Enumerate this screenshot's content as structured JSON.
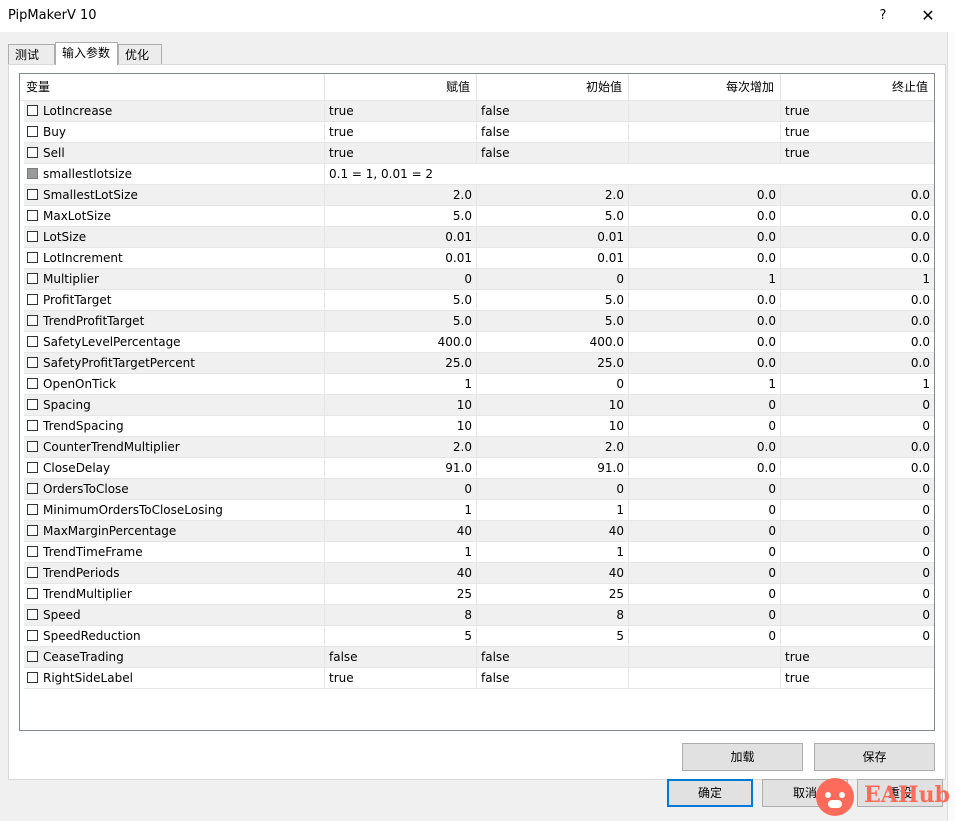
{
  "window": {
    "title": "PipMakerV 10",
    "help_label": "?",
    "close_label": "✕"
  },
  "tabs": [
    {
      "label": "测试",
      "active": false
    },
    {
      "label": "输入参数",
      "active": true
    },
    {
      "label": "优化",
      "active": false
    }
  ],
  "columns": [
    "变量",
    "赋值",
    "初始值",
    "每次增加",
    "终止值"
  ],
  "rows": [
    {
      "name": "LotIncrease",
      "value": "true",
      "start": "false",
      "step": "",
      "stop": "true",
      "type": "text"
    },
    {
      "name": "Buy",
      "value": "true",
      "start": "false",
      "step": "",
      "stop": "true",
      "type": "text"
    },
    {
      "name": "Sell",
      "value": "true",
      "start": "false",
      "step": "",
      "stop": "true",
      "type": "text"
    },
    {
      "name": "smallestlotsize",
      "value": "0.1 = 1, 0.01 = 2",
      "start": "",
      "step": "",
      "stop": "",
      "type": "comment"
    },
    {
      "name": "SmallestLotSize",
      "value": "2.0",
      "start": "2.0",
      "step": "0.0",
      "stop": "0.0",
      "type": "num"
    },
    {
      "name": "MaxLotSize",
      "value": "5.0",
      "start": "5.0",
      "step": "0.0",
      "stop": "0.0",
      "type": "num"
    },
    {
      "name": "LotSize",
      "value": "0.01",
      "start": "0.01",
      "step": "0.0",
      "stop": "0.0",
      "type": "num"
    },
    {
      "name": "LotIncrement",
      "value": "0.01",
      "start": "0.01",
      "step": "0.0",
      "stop": "0.0",
      "type": "num"
    },
    {
      "name": "Multiplier",
      "value": "0",
      "start": "0",
      "step": "1",
      "stop": "1",
      "type": "num"
    },
    {
      "name": "ProfitTarget",
      "value": "5.0",
      "start": "5.0",
      "step": "0.0",
      "stop": "0.0",
      "type": "num"
    },
    {
      "name": "TrendProfitTarget",
      "value": "5.0",
      "start": "5.0",
      "step": "0.0",
      "stop": "0.0",
      "type": "num"
    },
    {
      "name": "SafetyLevelPercentage",
      "value": "400.0",
      "start": "400.0",
      "step": "0.0",
      "stop": "0.0",
      "type": "num"
    },
    {
      "name": "SafetyProfitTargetPercent",
      "value": "25.0",
      "start": "25.0",
      "step": "0.0",
      "stop": "0.0",
      "type": "num"
    },
    {
      "name": "OpenOnTick",
      "value": "1",
      "start": "0",
      "step": "1",
      "stop": "1",
      "type": "num"
    },
    {
      "name": "Spacing",
      "value": "10",
      "start": "10",
      "step": "0",
      "stop": "0",
      "type": "num"
    },
    {
      "name": "TrendSpacing",
      "value": "10",
      "start": "10",
      "step": "0",
      "stop": "0",
      "type": "num"
    },
    {
      "name": "CounterTrendMultiplier",
      "value": "2.0",
      "start": "2.0",
      "step": "0.0",
      "stop": "0.0",
      "type": "num"
    },
    {
      "name": "CloseDelay",
      "value": "91.0",
      "start": "91.0",
      "step": "0.0",
      "stop": "0.0",
      "type": "num"
    },
    {
      "name": "OrdersToClose",
      "value": "0",
      "start": "0",
      "step": "0",
      "stop": "0",
      "type": "num"
    },
    {
      "name": "MinimumOrdersToCloseLosing",
      "value": "1",
      "start": "1",
      "step": "0",
      "stop": "0",
      "type": "num"
    },
    {
      "name": "MaxMarginPercentage",
      "value": "40",
      "start": "40",
      "step": "0",
      "stop": "0",
      "type": "num"
    },
    {
      "name": "TrendTimeFrame",
      "value": "1",
      "start": "1",
      "step": "0",
      "stop": "0",
      "type": "num"
    },
    {
      "name": "TrendPeriods",
      "value": "40",
      "start": "40",
      "step": "0",
      "stop": "0",
      "type": "num"
    },
    {
      "name": "TrendMultiplier",
      "value": "25",
      "start": "25",
      "step": "0",
      "stop": "0",
      "type": "num"
    },
    {
      "name": "Speed",
      "value": "8",
      "start": "8",
      "step": "0",
      "stop": "0",
      "type": "num"
    },
    {
      "name": "SpeedReduction",
      "value": "5",
      "start": "5",
      "step": "0",
      "stop": "0",
      "type": "num"
    },
    {
      "name": "CeaseTrading",
      "value": "false",
      "start": "false",
      "step": "",
      "stop": "true",
      "type": "text"
    },
    {
      "name": "RightSideLabel",
      "value": "true",
      "start": "false",
      "step": "",
      "stop": "true",
      "type": "text"
    }
  ],
  "buttons": {
    "load": "加载",
    "save": "保存",
    "ok": "确定",
    "cancel": "取消",
    "reset": "重设"
  },
  "watermark": {
    "text": "EAHub",
    "color": "#ff6b5b"
  }
}
